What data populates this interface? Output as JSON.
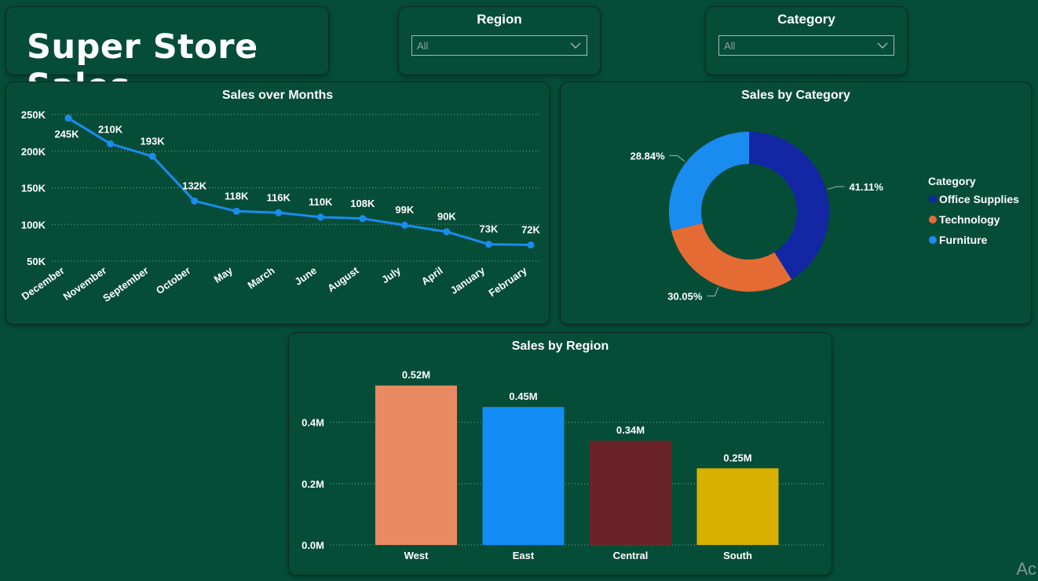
{
  "dashboard": {
    "title": "Super Store Sales"
  },
  "slicers": {
    "region": {
      "label": "Region",
      "value": "All"
    },
    "category": {
      "label": "Category",
      "value": "All"
    }
  },
  "colors": {
    "background": "#064d37",
    "line": "#1a8cf0",
    "office_supplies": "#1326a3",
    "technology": "#e56b35",
    "furniture": "#1a8cf0",
    "west": "#ea8a63",
    "east": "#118df5",
    "central": "#6b232a",
    "south": "#d8b100"
  },
  "watermark": "Ac",
  "chart_data": [
    {
      "type": "line",
      "title": "Sales over Months",
      "categories": [
        "December",
        "November",
        "September",
        "October",
        "May",
        "March",
        "June",
        "August",
        "July",
        "April",
        "January",
        "February"
      ],
      "values": [
        245,
        210,
        193,
        132,
        118,
        116,
        110,
        108,
        99,
        90,
        73,
        72
      ],
      "data_labels": [
        "245K",
        "210K",
        "193K",
        "132K",
        "118K",
        "116K",
        "110K",
        "108K",
        "99K",
        "90K",
        "73K",
        "72K"
      ],
      "yticks": [
        "250K",
        "200K",
        "150K",
        "100K",
        "50K"
      ],
      "ytick_values": [
        250,
        200,
        150,
        100,
        50
      ],
      "ylim": [
        50,
        250
      ],
      "grid": true
    },
    {
      "type": "pie",
      "title": "Sales by Category",
      "legend_title": "Category",
      "legend_position": "right",
      "labels": [
        "Office Supplies",
        "Technology",
        "Furniture"
      ],
      "values": [
        41.11,
        30.05,
        28.84
      ],
      "data_labels": [
        "41.11%",
        "30.05%",
        "28.84%"
      ]
    },
    {
      "type": "bar",
      "title": "Sales by Region",
      "categories": [
        "West",
        "East",
        "Central",
        "South"
      ],
      "values": [
        0.52,
        0.45,
        0.34,
        0.25
      ],
      "data_labels": [
        "0.52M",
        "0.45M",
        "0.34M",
        "0.25M"
      ],
      "yticks": [
        "0.0M",
        "0.2M",
        "0.4M"
      ],
      "ytick_values": [
        0,
        0.2,
        0.4
      ],
      "ylim": [
        0,
        0.55
      ],
      "grid": true
    }
  ]
}
